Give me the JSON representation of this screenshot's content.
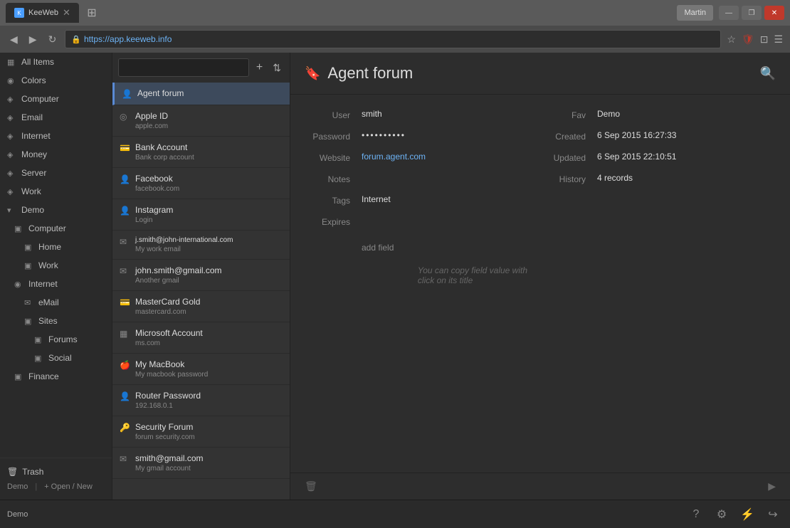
{
  "browser": {
    "tab_title": "KeeWeb",
    "tab_favicon": "K",
    "url": "https://app.keeweb.info",
    "user_label": "Martin",
    "win_minimize": "—",
    "win_restore": "❐",
    "win_close": "✕"
  },
  "toolbar": {
    "search_placeholder": "",
    "add_btn": "+",
    "sort_btn": "⇅"
  },
  "sidebar": {
    "items": [
      {
        "id": "all-items",
        "label": "All Items",
        "icon": "▦",
        "indent": 0
      },
      {
        "id": "colors",
        "label": "Colors",
        "icon": "◉",
        "indent": 0
      },
      {
        "id": "computer",
        "label": "Computer",
        "icon": "◈",
        "indent": 0
      },
      {
        "id": "email",
        "label": "Email",
        "icon": "◈",
        "indent": 0
      },
      {
        "id": "internet",
        "label": "Internet",
        "icon": "◈",
        "indent": 0
      },
      {
        "id": "money",
        "label": "Money",
        "icon": "◈",
        "indent": 0
      },
      {
        "id": "server",
        "label": "Server",
        "icon": "◈",
        "indent": 0
      },
      {
        "id": "work",
        "label": "Work",
        "icon": "◈",
        "indent": 0
      },
      {
        "id": "demo",
        "label": "Demo",
        "icon": "▾",
        "indent": 0
      },
      {
        "id": "demo-computer",
        "label": "Computer",
        "icon": "▣",
        "indent": 1
      },
      {
        "id": "demo-home",
        "label": "Home",
        "icon": "▣",
        "indent": 2
      },
      {
        "id": "demo-work",
        "label": "Work",
        "icon": "▣",
        "indent": 2
      },
      {
        "id": "demo-internet",
        "label": "Internet",
        "icon": "◉",
        "indent": 1
      },
      {
        "id": "demo-email",
        "label": "eMail",
        "icon": "✉",
        "indent": 2
      },
      {
        "id": "demo-sites",
        "label": "Sites",
        "icon": "▣",
        "indent": 2
      },
      {
        "id": "demo-forums",
        "label": "Forums",
        "icon": "▣",
        "indent": 3
      },
      {
        "id": "demo-social",
        "label": "Social",
        "icon": "▣",
        "indent": 3
      },
      {
        "id": "demo-finance",
        "label": "Finance",
        "icon": "▣",
        "indent": 1
      }
    ],
    "trash_label": "Trash",
    "db_label": "Demo",
    "open_new_label": "+ Open / New"
  },
  "entries": [
    {
      "id": "agent-forum",
      "name": "Agent forum",
      "sub": "",
      "icon": "👤",
      "active": true
    },
    {
      "id": "apple-id",
      "name": "Apple ID",
      "sub": "apple.com",
      "icon": "◎"
    },
    {
      "id": "bank-account",
      "name": "Bank Account",
      "sub": "Bank corp account",
      "icon": "💳"
    },
    {
      "id": "facebook",
      "name": "Facebook",
      "sub": "facebook.com",
      "icon": "👤"
    },
    {
      "id": "instagram",
      "name": "Instagram",
      "sub": "Login",
      "icon": "👤"
    },
    {
      "id": "j-smith",
      "name": "j.smith@john-international.com",
      "sub": "My work email",
      "icon": "✉"
    },
    {
      "id": "john-gmail",
      "name": "john.smith@gmail.com",
      "sub": "Another gmail",
      "icon": "✉"
    },
    {
      "id": "mastercard",
      "name": "MasterCard Gold",
      "sub": "mastercard.com",
      "icon": "💳"
    },
    {
      "id": "microsoft",
      "name": "Microsoft Account",
      "sub": "ms.com",
      "icon": "▦"
    },
    {
      "id": "macbook",
      "name": "My MacBook",
      "sub": "My macbook password",
      "icon": "🍎"
    },
    {
      "id": "router",
      "name": "Router Password",
      "sub": "192.168.0.1",
      "icon": "👤"
    },
    {
      "id": "security-forum",
      "name": "Security Forum",
      "sub": "forum security.com",
      "icon": "🔑"
    },
    {
      "id": "smith-gmail",
      "name": "smith@gmail.com",
      "sub": "My gmail account",
      "icon": "✉"
    }
  ],
  "detail": {
    "title": "Agent forum",
    "title_icon": "🔖",
    "fields": {
      "user_label": "User",
      "user_value": "smith",
      "password_label": "Password",
      "password_value": "••••••••••",
      "website_label": "Website",
      "website_value": "forum.agent.com",
      "notes_label": "Notes",
      "notes_value": "",
      "tags_label": "Tags",
      "tags_value": "Internet",
      "expires_label": "Expires",
      "expires_value": "",
      "add_field_label": "add field",
      "fav_label": "Fav",
      "fav_value": "Demo",
      "created_label": "Created",
      "created_value": "6 Sep 2015 16:27:33",
      "updated_label": "Updated",
      "updated_value": "6 Sep 2015 22:10:51",
      "history_label": "History",
      "history_value": "4 records"
    },
    "hint": "You can copy field value with click on its title",
    "delete_icon": "🗑"
  },
  "bottom_bar": {
    "db_label": "Demo",
    "help_icon": "?",
    "settings_icon": "⚙",
    "lock_icon": "⚡",
    "logout_icon": "↪"
  }
}
